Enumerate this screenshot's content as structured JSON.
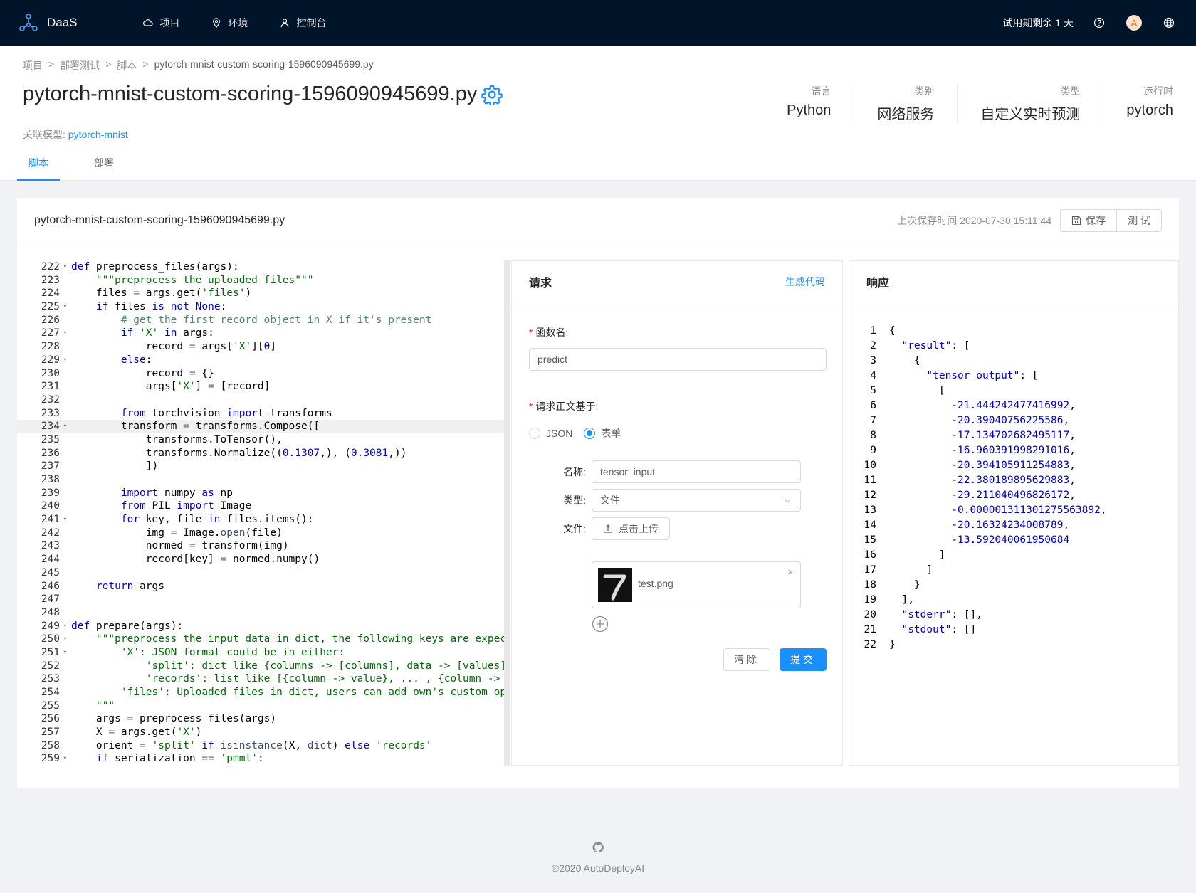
{
  "app": {
    "name": "DaaS"
  },
  "nav": {
    "items": [
      {
        "label": "项目",
        "icon": "cloud-icon"
      },
      {
        "label": "环境",
        "icon": "location-icon"
      },
      {
        "label": "控制台",
        "icon": "user-icon"
      }
    ],
    "trial": "试用期剩余 1 天",
    "avatar_letter": "A"
  },
  "breadcrumb": [
    "项目",
    ">",
    "部署测试",
    ">",
    "脚本",
    ">",
    "pytorch-mnist-custom-scoring-1596090945699.py"
  ],
  "page": {
    "title": "pytorch-mnist-custom-scoring-1596090945699.py",
    "related_label": "关联模型:",
    "related_model": "pytorch-mnist"
  },
  "meta": [
    {
      "label": "语言",
      "value": "Python"
    },
    {
      "label": "类别",
      "value": "网络服务"
    },
    {
      "label": "类型",
      "value": "自定义实时预测"
    },
    {
      "label": "运行时",
      "value": "pytorch"
    }
  ],
  "tabs": [
    {
      "label": "脚本",
      "active": true
    },
    {
      "label": "部署",
      "active": false
    }
  ],
  "card": {
    "title": "pytorch-mnist-custom-scoring-1596090945699.py",
    "saved": "上次保存时间 2020-07-30 15:11:44",
    "save_label": "保存",
    "test_label": "测 试"
  },
  "code": {
    "highlight_line": 234,
    "lines": [
      {
        "n": "222",
        "fold": true,
        "html": "<span class=\"kw\">def</span> preprocess_files(args):"
      },
      {
        "n": "223",
        "fold": false,
        "html": "    <span class=\"st\">\"\"\"preprocess the uploaded files\"\"\"</span>"
      },
      {
        "n": "224",
        "fold": false,
        "html": "    files <span class=\"op\">=</span> args.get(<span class=\"st\">'files'</span>)"
      },
      {
        "n": "225",
        "fold": true,
        "html": "    <span class=\"kw\">if</span> files <span class=\"kw\">is not</span> <span class=\"nm\">None</span>:"
      },
      {
        "n": "226",
        "fold": false,
        "html": "        <span class=\"cm\"># get the first record object in X if it's present</span>"
      },
      {
        "n": "227",
        "fold": true,
        "html": "        <span class=\"kw\">if</span> <span class=\"st\">'X'</span> <span class=\"kw\">in</span> args:"
      },
      {
        "n": "228",
        "fold": false,
        "html": "            record <span class=\"op\">=</span> args[<span class=\"st\">'X'</span>][<span class=\"nm\">0</span>]"
      },
      {
        "n": "229",
        "fold": true,
        "html": "        <span class=\"kw\">else</span>:"
      },
      {
        "n": "230",
        "fold": false,
        "html": "            record <span class=\"op\">=</span> {}"
      },
      {
        "n": "231",
        "fold": false,
        "html": "            args[<span class=\"st\">'X'</span>] <span class=\"op\">=</span> [record]"
      },
      {
        "n": "232",
        "fold": false,
        "html": ""
      },
      {
        "n": "233",
        "fold": false,
        "html": "        <span class=\"kw\">from</span> torchvision <span class=\"kw\">import</span> transforms"
      },
      {
        "n": "234",
        "fold": true,
        "html": "        transform <span class=\"op\">=</span> transforms.Compose(["
      },
      {
        "n": "235",
        "fold": false,
        "html": "            transforms.ToTensor(),"
      },
      {
        "n": "236",
        "fold": false,
        "html": "            transforms.Normalize((<span class=\"nm\">0.1307</span>,), (<span class=\"nm\">0.3081</span>,))"
      },
      {
        "n": "237",
        "fold": false,
        "html": "            ])"
      },
      {
        "n": "238",
        "fold": false,
        "html": ""
      },
      {
        "n": "239",
        "fold": false,
        "html": "        <span class=\"kw\">import</span> numpy <span class=\"kw\">as</span> np"
      },
      {
        "n": "240",
        "fold": false,
        "html": "        <span class=\"kw\">from</span> PIL <span class=\"kw\">import</span> Image"
      },
      {
        "n": "241",
        "fold": true,
        "html": "        <span class=\"kw\">for</span> key, file <span class=\"kw\">in</span> files.items():"
      },
      {
        "n": "242",
        "fold": false,
        "html": "            img <span class=\"op\">=</span> Image.<span class=\"bi\">open</span>(file)"
      },
      {
        "n": "243",
        "fold": false,
        "html": "            normed <span class=\"op\">=</span> transform(img)"
      },
      {
        "n": "244",
        "fold": false,
        "html": "            record[key] <span class=\"op\">=</span> normed.numpy()"
      },
      {
        "n": "245",
        "fold": false,
        "html": ""
      },
      {
        "n": "246",
        "fold": false,
        "html": "    <span class=\"kw\">return</span> args"
      },
      {
        "n": "247",
        "fold": false,
        "html": ""
      },
      {
        "n": "248",
        "fold": false,
        "html": ""
      },
      {
        "n": "249",
        "fold": true,
        "html": "<span class=\"kw\">def</span> prepare(args):"
      },
      {
        "n": "250",
        "fold": true,
        "html": "    <span class=\"st\">\"\"\"preprocess the input data in dict, the following keys are expected:</span>"
      },
      {
        "n": "251",
        "fold": true,
        "html": "<span class=\"st\">        'X': JSON format could be in either:</span>"
      },
      {
        "n": "252",
        "fold": false,
        "html": "<span class=\"st\">            'split': dict like {columns -> [columns], data -> [values]}</span>"
      },
      {
        "n": "253",
        "fold": false,
        "html": "<span class=\"st\">            'records': list like [{column -> value}, ... , {column -> valu</span>"
      },
      {
        "n": "254",
        "fold": false,
        "html": "<span class=\"st\">        'files': Uploaded files in dict, users can add own's custom operat</span>"
      },
      {
        "n": "255",
        "fold": false,
        "html": "<span class=\"st\">    \"\"\"</span>"
      },
      {
        "n": "256",
        "fold": false,
        "html": "    args <span class=\"op\">=</span> preprocess_files(args)"
      },
      {
        "n": "257",
        "fold": false,
        "html": "    X <span class=\"op\">=</span> args.get(<span class=\"st\">'X'</span>)"
      },
      {
        "n": "258",
        "fold": false,
        "html": "    orient <span class=\"op\">=</span> <span class=\"st\">'split'</span> <span class=\"kw\">if</span> <span class=\"bi\">isinstance</span>(X, <span class=\"bi\">dict</span>) <span class=\"kw\">else</span> <span class=\"st\">'records'</span>"
      },
      {
        "n": "259",
        "fold": true,
        "html": "    <span class=\"kw\">if</span> serialization <span class=\"op\">==</span> <span class=\"st\">'pmml'</span>:"
      }
    ]
  },
  "request": {
    "title": "请求",
    "gen_code": "生成代码",
    "func_label": "函数名:",
    "func_value": "predict",
    "body_label": "请求正文基于:",
    "radio_json": "JSON",
    "radio_form": "表单",
    "name_label": "名称:",
    "name_value": "tensor_input",
    "type_label": "类型:",
    "type_value": "文件",
    "file_label": "文件:",
    "upload_label": "点击上传",
    "file_name": "test.png",
    "file_close": "×",
    "clear_label": "清除",
    "submit_label": "提交"
  },
  "response": {
    "title": "响应",
    "lines": [
      {
        "n": "1",
        "html": "{"
      },
      {
        "n": "2",
        "html": "  <span class=\"jk\">\"result\"</span>: ["
      },
      {
        "n": "3",
        "html": "    {"
      },
      {
        "n": "4",
        "html": "      <span class=\"jk\">\"tensor_output\"</span>: ["
      },
      {
        "n": "5",
        "html": "        ["
      },
      {
        "n": "6",
        "html": "          <span class=\"jn\">-21.444242477416992</span>,"
      },
      {
        "n": "7",
        "html": "          <span class=\"jn\">-20.39040756225586</span>,"
      },
      {
        "n": "8",
        "html": "          <span class=\"jn\">-17.134702682495117</span>,"
      },
      {
        "n": "9",
        "html": "          <span class=\"jn\">-16.960391998291016</span>,"
      },
      {
        "n": "10",
        "html": "          <span class=\"jn\">-20.394105911254883</span>,"
      },
      {
        "n": "11",
        "html": "          <span class=\"jn\">-22.380189895629883</span>,"
      },
      {
        "n": "12",
        "html": "          <span class=\"jn\">-29.211040496826172</span>,"
      },
      {
        "n": "13",
        "html": "          <span class=\"jn\">-0.000001311301275563892</span>,"
      },
      {
        "n": "14",
        "html": "          <span class=\"jn\">-20.16324234008789</span>,"
      },
      {
        "n": "15",
        "html": "          <span class=\"jn\">-13.592040061950684</span>"
      },
      {
        "n": "16",
        "html": "        ]"
      },
      {
        "n": "17",
        "html": "      ]"
      },
      {
        "n": "18",
        "html": "    }"
      },
      {
        "n": "19",
        "html": "  ],"
      },
      {
        "n": "20",
        "html": "  <span class=\"jk\">\"stderr\"</span>: [],"
      },
      {
        "n": "21",
        "html": "  <span class=\"jk\">\"stdout\"</span>: []"
      },
      {
        "n": "22",
        "html": "}"
      }
    ]
  },
  "footer": {
    "copyright": "©2020 AutoDeployAI"
  },
  "colors": {
    "nav_bg": "#001529",
    "accent": "#1890ff",
    "required": "#f5222d"
  }
}
